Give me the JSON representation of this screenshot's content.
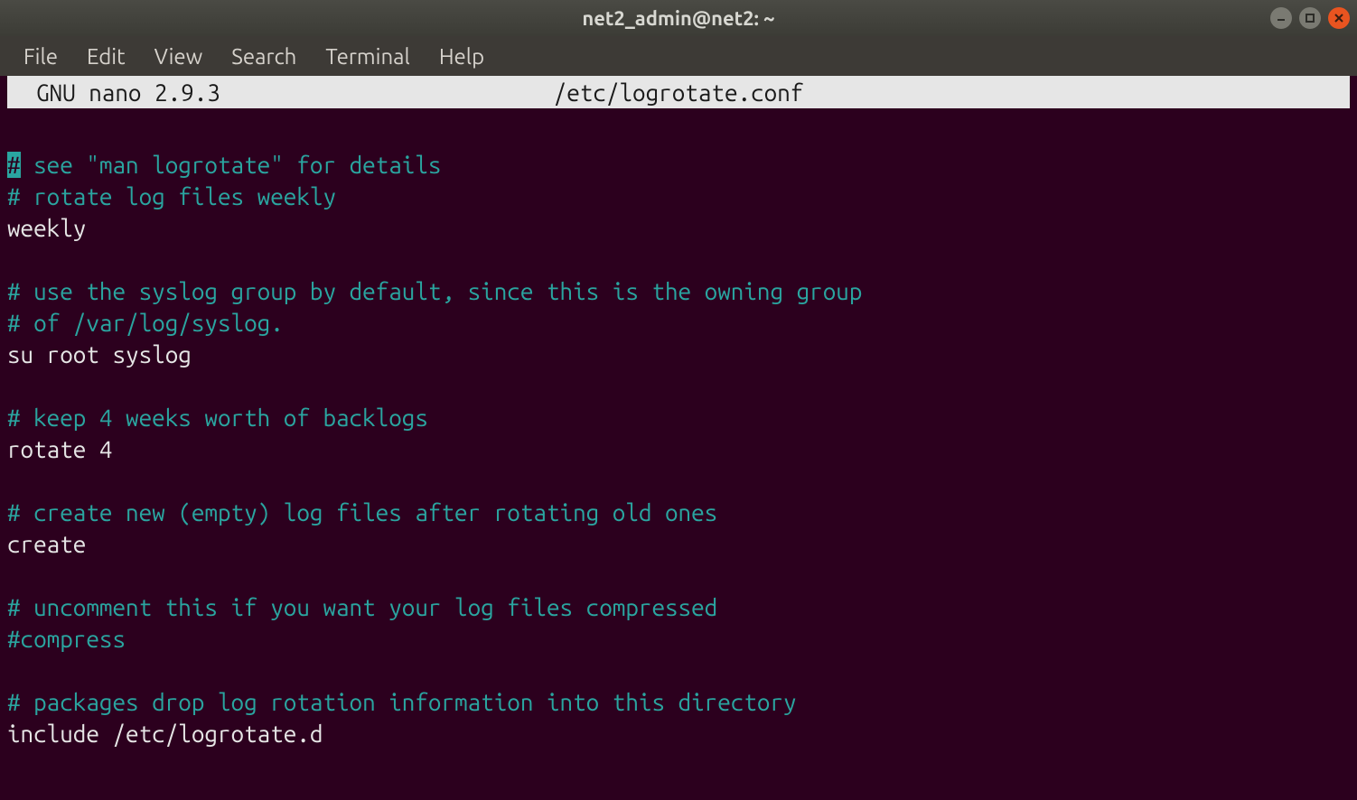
{
  "window": {
    "title": "net2_admin@net2: ~"
  },
  "menubar": {
    "items": [
      "File",
      "Edit",
      "View",
      "Search",
      "Terminal",
      "Help"
    ]
  },
  "nano": {
    "app_label": "GNU nano 2.9.3",
    "filename": "/etc/logrotate.conf"
  },
  "editor_lines": [
    {
      "type": "cursor-comment",
      "cursor": "#",
      "rest": " see \"man logrotate\" for details"
    },
    {
      "type": "comment",
      "text": "# rotate log files weekly"
    },
    {
      "type": "plain",
      "text": "weekly"
    },
    {
      "type": "blank",
      "text": ""
    },
    {
      "type": "comment",
      "text": "# use the syslog group by default, since this is the owning group"
    },
    {
      "type": "comment",
      "text": "# of /var/log/syslog."
    },
    {
      "type": "plain",
      "text": "su root syslog"
    },
    {
      "type": "blank",
      "text": ""
    },
    {
      "type": "comment",
      "text": "# keep 4 weeks worth of backlogs"
    },
    {
      "type": "plain",
      "text": "rotate 4"
    },
    {
      "type": "blank",
      "text": ""
    },
    {
      "type": "comment",
      "text": "# create new (empty) log files after rotating old ones"
    },
    {
      "type": "plain",
      "text": "create"
    },
    {
      "type": "blank",
      "text": ""
    },
    {
      "type": "comment",
      "text": "# uncomment this if you want your log files compressed"
    },
    {
      "type": "comment",
      "text": "#compress"
    },
    {
      "type": "blank",
      "text": ""
    },
    {
      "type": "comment",
      "text": "# packages drop log rotation information into this directory"
    },
    {
      "type": "plain",
      "text": "include /etc/logrotate.d"
    }
  ]
}
